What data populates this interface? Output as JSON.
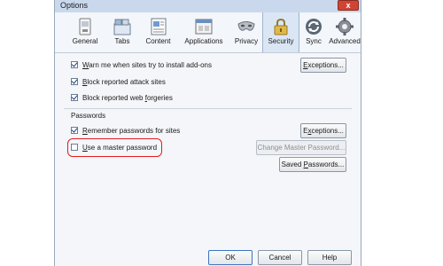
{
  "window": {
    "title": "Options",
    "close_label": "x"
  },
  "toolbar": {
    "tabs": [
      {
        "label": "General",
        "icon": "general-icon"
      },
      {
        "label": "Tabs",
        "icon": "tabs-icon"
      },
      {
        "label": "Content",
        "icon": "content-icon"
      },
      {
        "label": "Applications",
        "icon": "applications-icon"
      },
      {
        "label": "Privacy",
        "icon": "privacy-mask-icon"
      },
      {
        "label": "Security",
        "icon": "security-lock-icon",
        "selected": true
      },
      {
        "label": "Sync",
        "icon": "sync-icon"
      },
      {
        "label": "Advanced",
        "icon": "advanced-gear-icon"
      }
    ]
  },
  "security": {
    "warn_addons": {
      "pre": "",
      "mnemonic": "W",
      "post": "arn me when sites try to install add-ons",
      "checked": true
    },
    "block_attack": {
      "pre": "",
      "mnemonic": "B",
      "post": "lock reported attack sites",
      "checked": true
    },
    "block_forgeries": {
      "pre": "Block reported web ",
      "mnemonic": "f",
      "post": "orgeries",
      "checked": true
    },
    "exceptions_label": {
      "pre": "",
      "mnemonic": "E",
      "post": "xceptions..."
    }
  },
  "passwords": {
    "section_label": "Passwords",
    "remember": {
      "pre": "",
      "mnemonic": "R",
      "post": "emember passwords for sites",
      "checked": true
    },
    "exceptions_label": {
      "pre": "E",
      "mnemonic": "x",
      "post": "ceptions..."
    },
    "master": {
      "pre": "",
      "mnemonic": "U",
      "post": "se a master password",
      "checked": false
    },
    "change_master_label": "Change Master Password...",
    "saved_passwords_label": {
      "pre": "Saved ",
      "mnemonic": "P",
      "post": "asswords..."
    }
  },
  "footer": {
    "ok_label": "OK",
    "cancel_label": "Cancel",
    "help_label": "Help"
  },
  "colors": {
    "highlight": "#e11e1e",
    "accent": "#3a76c2"
  }
}
